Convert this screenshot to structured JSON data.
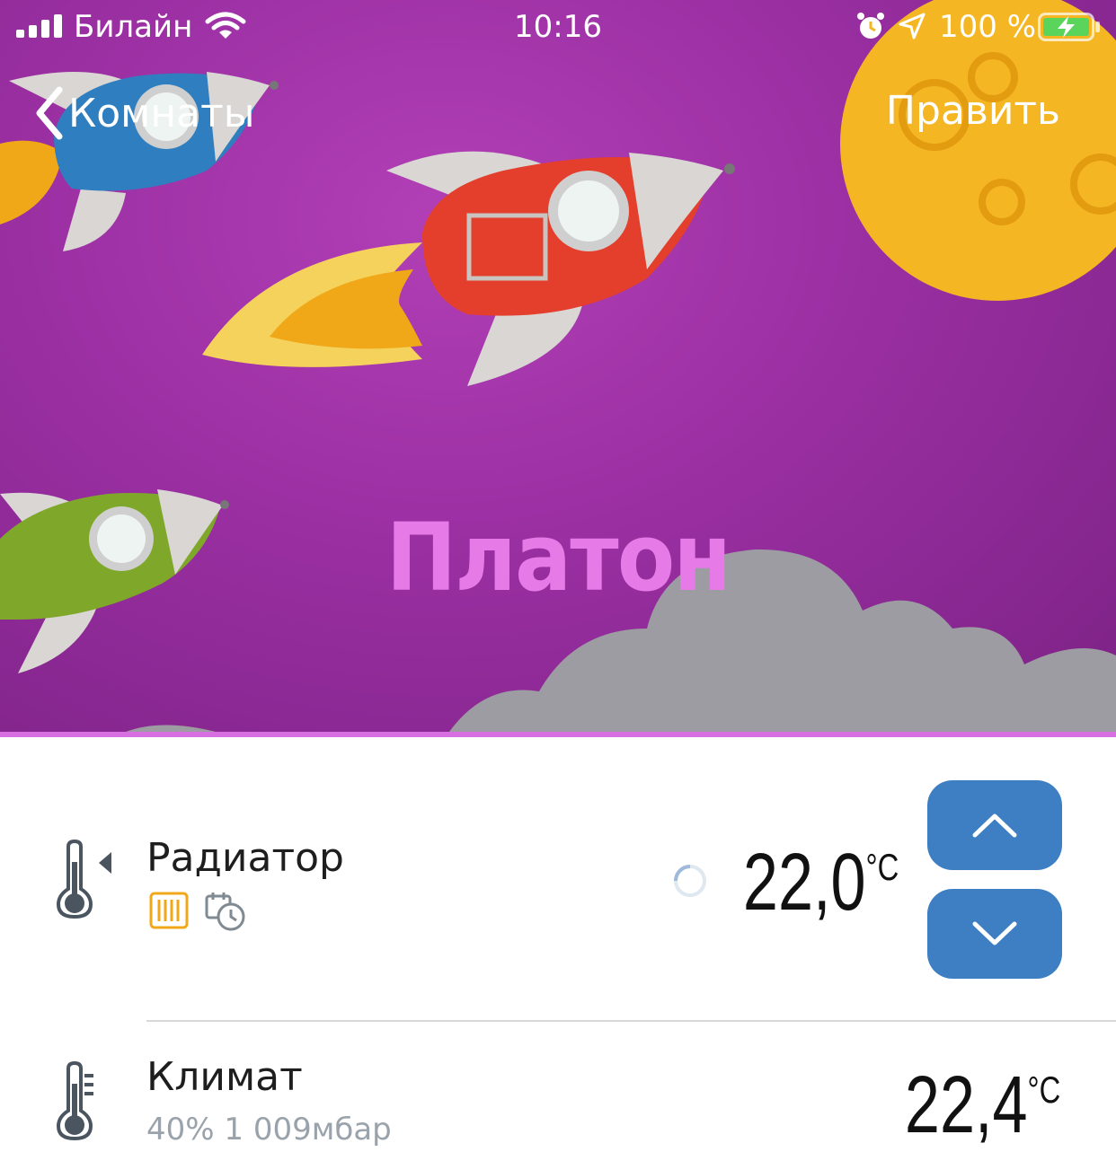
{
  "status_bar": {
    "carrier": "Билайн",
    "time": "10:16",
    "battery": "100 %"
  },
  "nav": {
    "back_label": "Комнаты",
    "edit_label": "Править"
  },
  "room": {
    "title": "Платон"
  },
  "devices": [
    {
      "name": "Радиатор",
      "temperature": "22,0",
      "unit": "°C",
      "loading": true
    },
    {
      "name": "Климат",
      "subtitle": "40% 1 009мбар",
      "temperature": "22,4",
      "unit": "°C"
    }
  ],
  "colors": {
    "accent_blue": "#3e7fc4",
    "title_pink": "#e67ae6",
    "radiator_orange": "#f0a818"
  }
}
